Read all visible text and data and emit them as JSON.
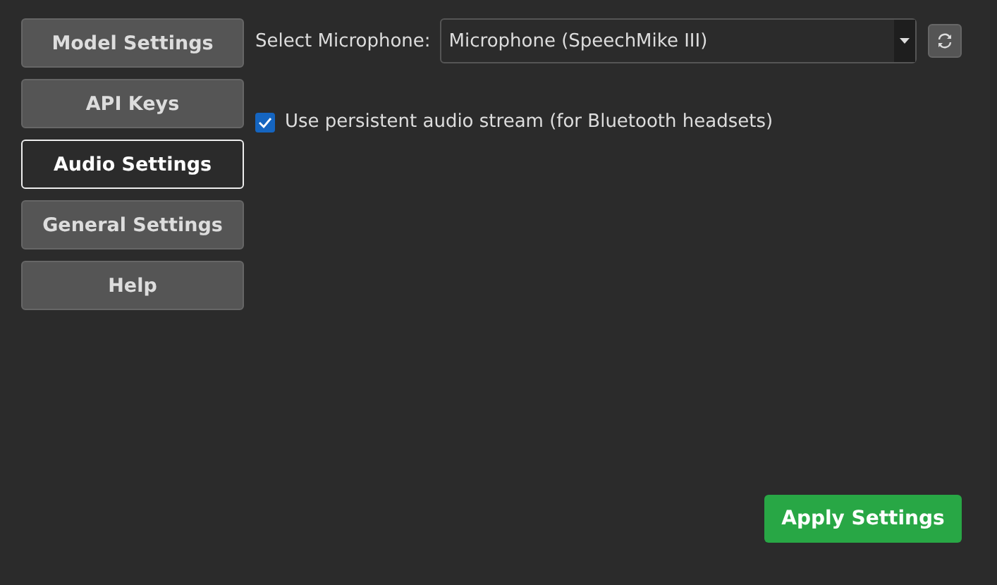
{
  "sidebar": {
    "items": [
      {
        "label": "Model Settings",
        "selected": false
      },
      {
        "label": "API Keys",
        "selected": false
      },
      {
        "label": "Audio Settings",
        "selected": true
      },
      {
        "label": "General Settings",
        "selected": false
      },
      {
        "label": "Help",
        "selected": false
      }
    ]
  },
  "microphone": {
    "label": "Select Microphone:",
    "value": "Microphone (SpeechMike III)"
  },
  "persistent_stream": {
    "label": "Use persistent audio stream (for Bluetooth headsets)",
    "checked": true
  },
  "apply_button": "Apply Settings"
}
